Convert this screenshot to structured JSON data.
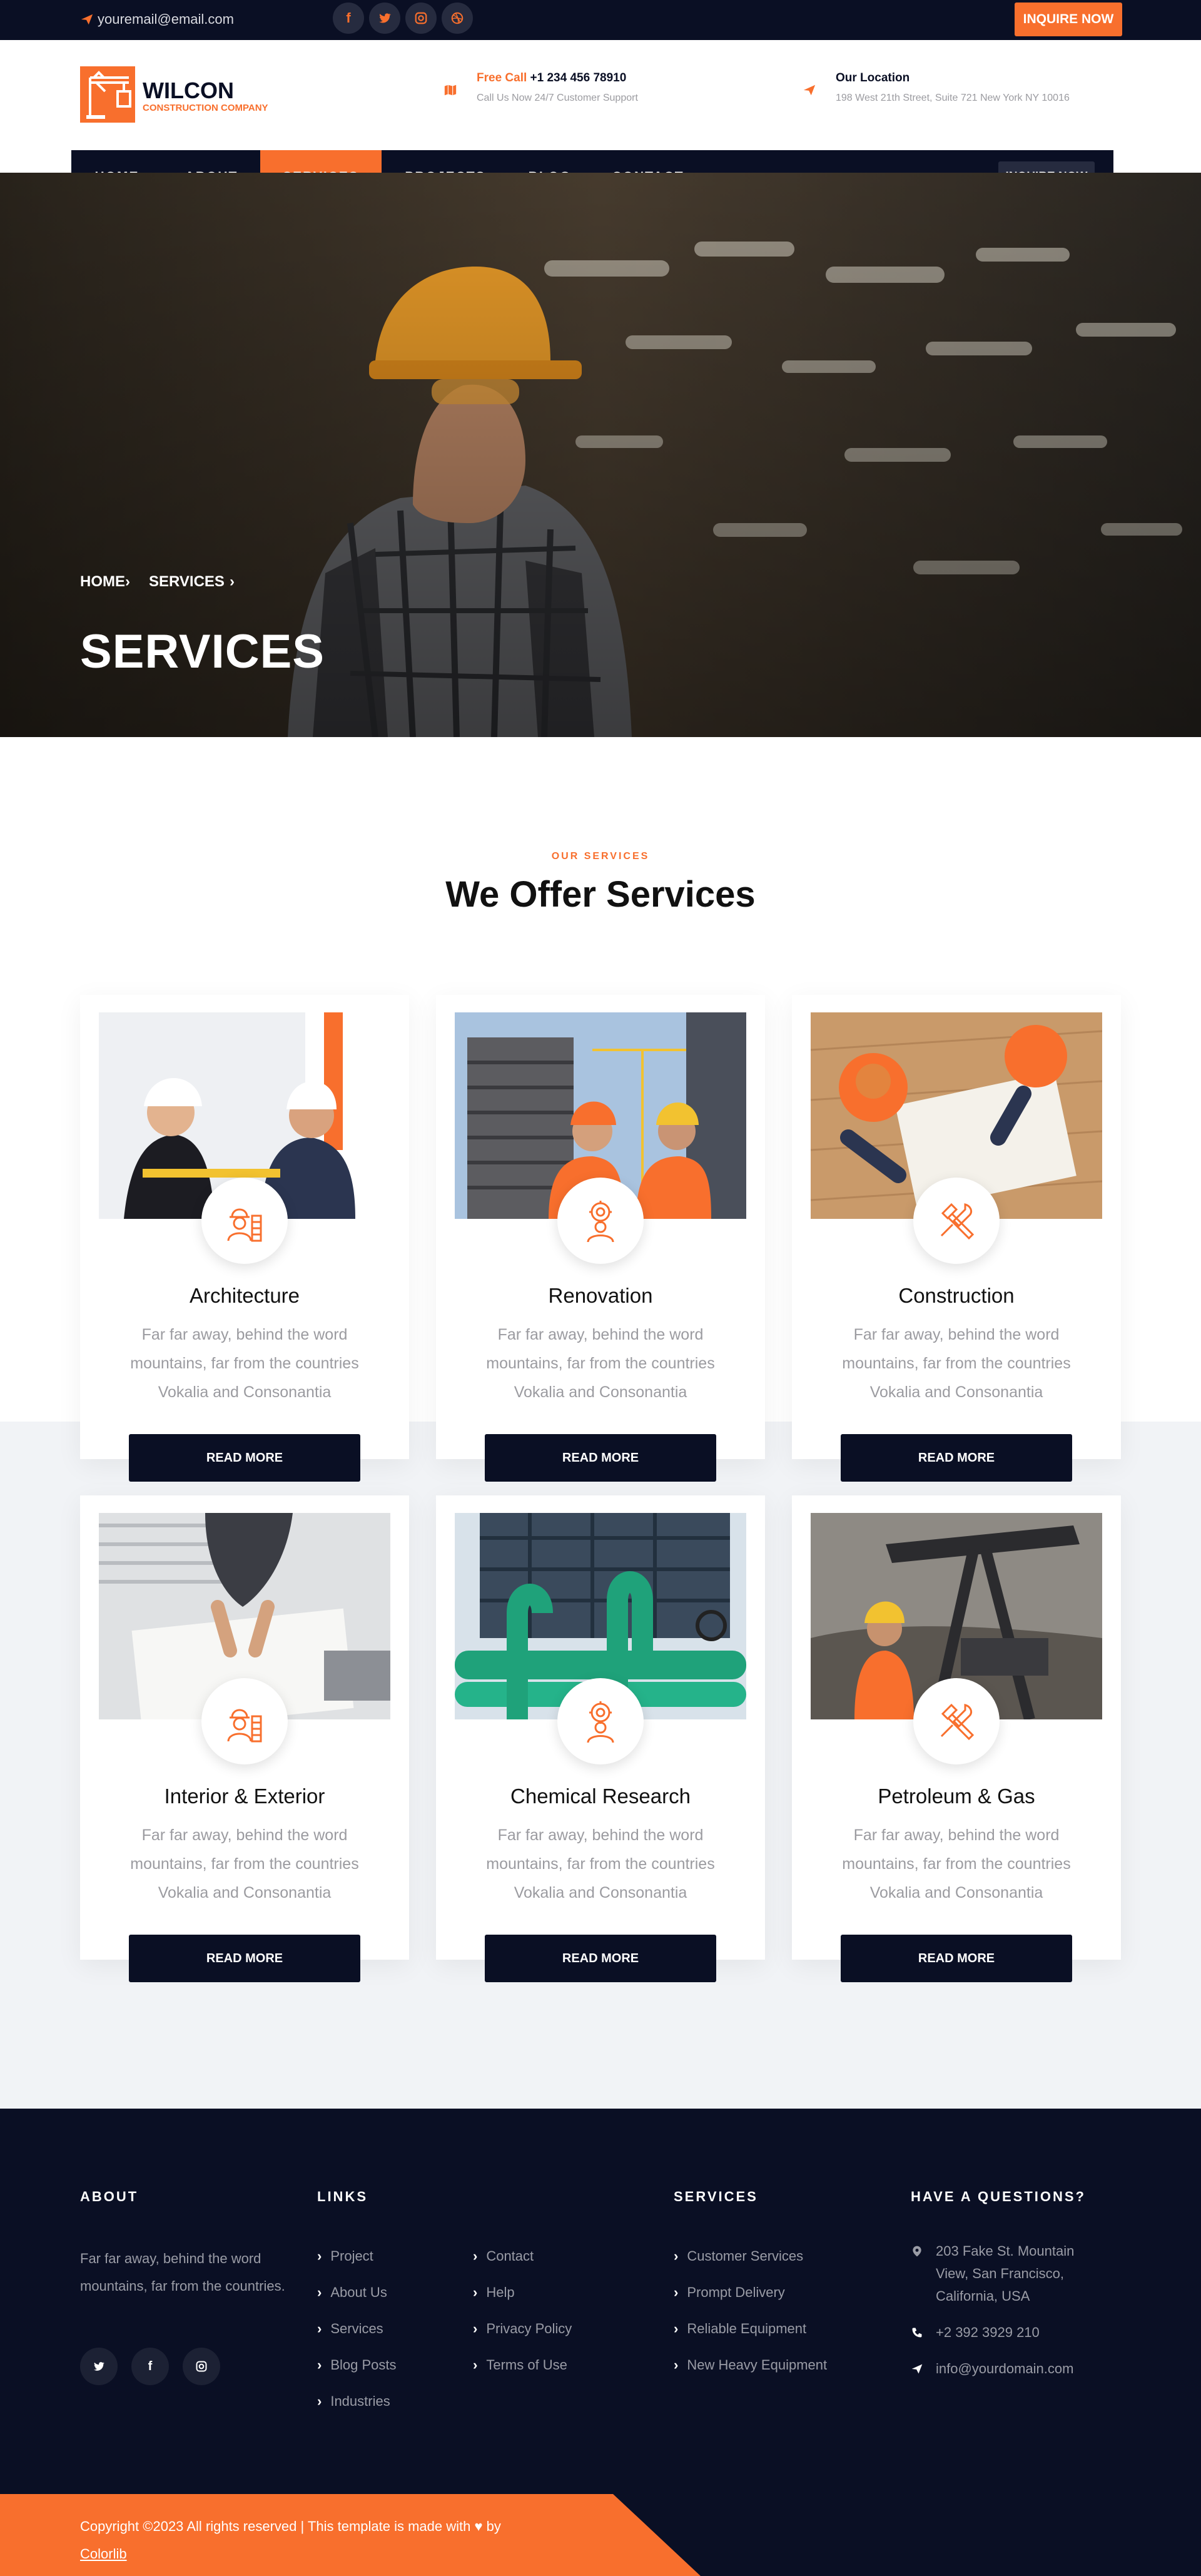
{
  "topbar": {
    "email": "youremail@email.com",
    "inquire_label": "INQUIRE NOW",
    "social": [
      {
        "icon": "facebook-icon",
        "glyph": "f"
      },
      {
        "icon": "twitter-icon",
        "glyph": "t"
      },
      {
        "icon": "instagram-icon",
        "glyph": "◎"
      },
      {
        "icon": "dribbble-icon",
        "glyph": "◍"
      }
    ]
  },
  "header": {
    "brand": "WILCON",
    "brand_sub": "CONSTRUCTION COMPANY",
    "call": {
      "label_accent": "Free Call",
      "number": "+1 234 456 78910",
      "sub": "Call Us Now 24/7 Customer Support"
    },
    "location": {
      "label": "Our Location",
      "sub": "198 West 21th Street, Suite 721 New York NY 10016"
    }
  },
  "nav": {
    "items": [
      "HOME",
      "ABOUT",
      "SERVICES",
      "PROJECTS",
      "BLOG",
      "CONTACT"
    ],
    "active": "SERVICES",
    "inquire_label": "INQUIRE NOW"
  },
  "hero": {
    "breadcrumb": [
      "HOME",
      "SERVICES"
    ],
    "title": "SERVICES"
  },
  "services": {
    "eyebrow": "OUR SERVICES",
    "heading": "We Offer Services",
    "cards": [
      {
        "title": "Architecture",
        "desc": "Far far away, behind the word mountains, far from the countries Vokalia and Consonantia",
        "button": "READ MORE",
        "icon": "architect-worker-icon"
      },
      {
        "title": "Renovation",
        "desc": "Far far away, behind the word mountains, far from the countries Vokalia and Consonantia",
        "button": "READ MORE",
        "icon": "gear-worker-icon"
      },
      {
        "title": "Construction",
        "desc": "Far far away, behind the word mountains, far from the countries Vokalia and Consonantia",
        "button": "READ MORE",
        "icon": "hammer-wrench-icon"
      },
      {
        "title": "Interior & Exterior",
        "desc": "Far far away, behind the word mountains, far from the countries Vokalia and Consonantia",
        "button": "READ MORE",
        "icon": "architect-worker-icon"
      },
      {
        "title": "Chemical Research",
        "desc": "Far far away, behind the word mountains, far from the countries Vokalia and Consonantia",
        "button": "READ MORE",
        "icon": "gear-worker-icon"
      },
      {
        "title": "Petroleum & Gas",
        "desc": "Far far away, behind the word mountains, far from the countries Vokalia and Consonantia",
        "button": "READ MORE",
        "icon": "hammer-wrench-icon"
      }
    ]
  },
  "footer": {
    "about_heading": "ABOUT",
    "about_text": "Far far away, behind the word mountains, far from the countries.",
    "social": [
      "twitter-icon",
      "facebook-icon",
      "instagram-icon"
    ],
    "links_heading": "LINKS",
    "links_col1": [
      "Project",
      "About Us",
      "Services",
      "Blog Posts",
      "Industries"
    ],
    "links_col2": [
      "Contact",
      "Help",
      "Privacy Policy",
      "Terms of Use"
    ],
    "services_heading": "SERVICES",
    "services_list": [
      "Customer Services",
      "Prompt Delivery",
      "Reliable Equipment",
      "New Heavy Equipment"
    ],
    "questions_heading": "HAVE A QUESTIONS?",
    "address": "203 Fake St. Mountain View, San Francisco, California, USA",
    "phone": "+2 392 3929 210",
    "email": "info@yourdomain.com",
    "copyright": "Copyright ©2023 All rights reserved | This template is made with",
    "copyright_by": "by",
    "credit": "Colorlib"
  },
  "colors": {
    "accent": "#f86f2d",
    "dark": "#0a0f24",
    "muted": "#9b9ba0"
  }
}
